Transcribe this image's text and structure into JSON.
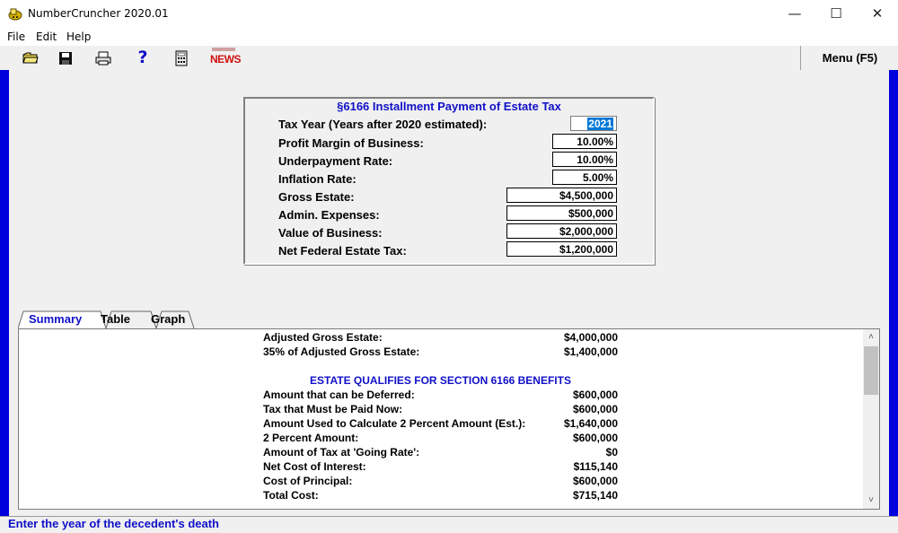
{
  "window": {
    "title": "NumberCruncher 2020.01",
    "minimize_glyph": "—",
    "maximize_glyph": "☐",
    "close_glyph": "✕"
  },
  "menu": {
    "file": "File",
    "edit": "Edit",
    "help": "Help"
  },
  "toolbar": {
    "news_label": "NEWS",
    "help_glyph": "?",
    "menu_button": "Menu (F5)",
    "icons": [
      "open-folder-icon",
      "save-disk-icon",
      "print-icon",
      "help-icon",
      "calculator-icon",
      "news-icon"
    ]
  },
  "panel": {
    "title": "§6166 Installment Payment of Estate Tax",
    "fields": [
      {
        "label": "Tax Year (Years after 2020 estimated):",
        "value": "2021"
      },
      {
        "label": "Profit Margin of Business:",
        "value": "10.00%"
      },
      {
        "label": "Underpayment Rate:",
        "value": "10.00%"
      },
      {
        "label": "Inflation Rate:",
        "value": "5.00%"
      },
      {
        "label": "Gross Estate:",
        "value": "$4,500,000"
      },
      {
        "label": "Admin. Expenses:",
        "value": "$500,000"
      },
      {
        "label": "Value of Business:",
        "value": "$2,000,000"
      },
      {
        "label": "Net Federal Estate Tax:",
        "value": "$1,200,000"
      }
    ]
  },
  "tabs": [
    "Summary",
    "Table",
    "Graph"
  ],
  "summary": {
    "rows_top": [
      {
        "label": "Adjusted Gross Estate:",
        "value": "$4,000,000"
      },
      {
        "label": "35% of Adjusted Gross Estate:",
        "value": "$1,400,000"
      }
    ],
    "qualify_text": "ESTATE QUALIFIES FOR SECTION 6166 BENEFITS",
    "rows_bottom": [
      {
        "label": "Amount that can be Deferred:",
        "value": "$600,000"
      },
      {
        "label": "Tax that Must be Paid Now:",
        "value": "$600,000"
      },
      {
        "label": "Amount Used to Calculate 2 Percent Amount (Est.):",
        "value": "$1,640,000"
      },
      {
        "label": "2 Percent Amount:",
        "value": "$600,000"
      },
      {
        "label": "Amount of Tax at 'Going Rate':",
        "value": "$0"
      },
      {
        "label": "Net Cost of Interest:",
        "value": "$115,140"
      },
      {
        "label": "Cost of Principal:",
        "value": "$600,000"
      },
      {
        "label": "Total Cost:",
        "value": "$715,140"
      }
    ]
  },
  "scroll": {
    "up_glyph": "˄",
    "down_glyph": "˅"
  },
  "status": {
    "text": "Enter the year of the decedent's death"
  },
  "colors": {
    "accent_blue": "#1010c8",
    "frame_blue": "#0000dd",
    "selection": "#0078d7"
  }
}
